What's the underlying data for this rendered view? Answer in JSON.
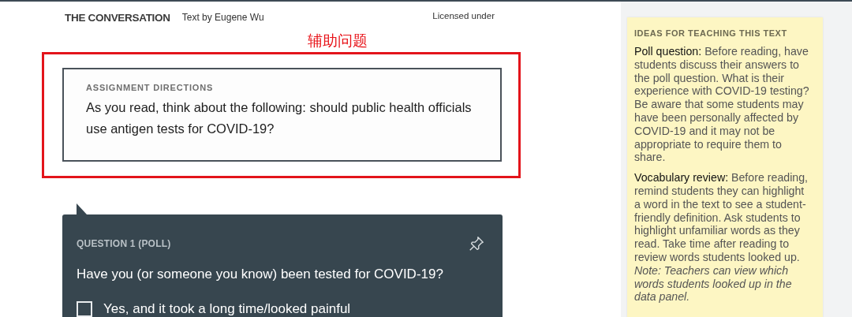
{
  "header": {
    "logo": "THE CONVERSATION",
    "byline": "Text by Eugene Wu",
    "license": "Licensed under"
  },
  "annotation": {
    "label": "辅助问题"
  },
  "directions": {
    "heading": "ASSIGNMENT DIRECTIONS",
    "text": "As you read, think about the following: should public health officials use antigen tests for COVID-19?"
  },
  "question": {
    "heading": "QUESTION 1 (POLL)",
    "text": "Have you (or someone you know) been tested for COVID-19?",
    "options": [
      {
        "label": "Yes, and it took a long time/looked painful",
        "checked": false
      }
    ]
  },
  "teaching_ideas": {
    "heading": "IDEAS FOR TEACHING THIS TEXT",
    "paragraphs": [
      "**Poll question:** Before reading, have students discuss their answers to the poll question. What is their experience with COVID-19 testing? Be aware that some students may have been personally affected by COVID-19 and it may not be appropriate to require them to share.",
      "**Vocabulary review:** Before reading, remind students they can highlight a word in the text to see a student-friendly definition. Ask students to highlight unfamiliar words as they read. Take time after reading to review words students looked up. *Note: Teachers can view which words students looked up in the data panel.*"
    ]
  }
}
